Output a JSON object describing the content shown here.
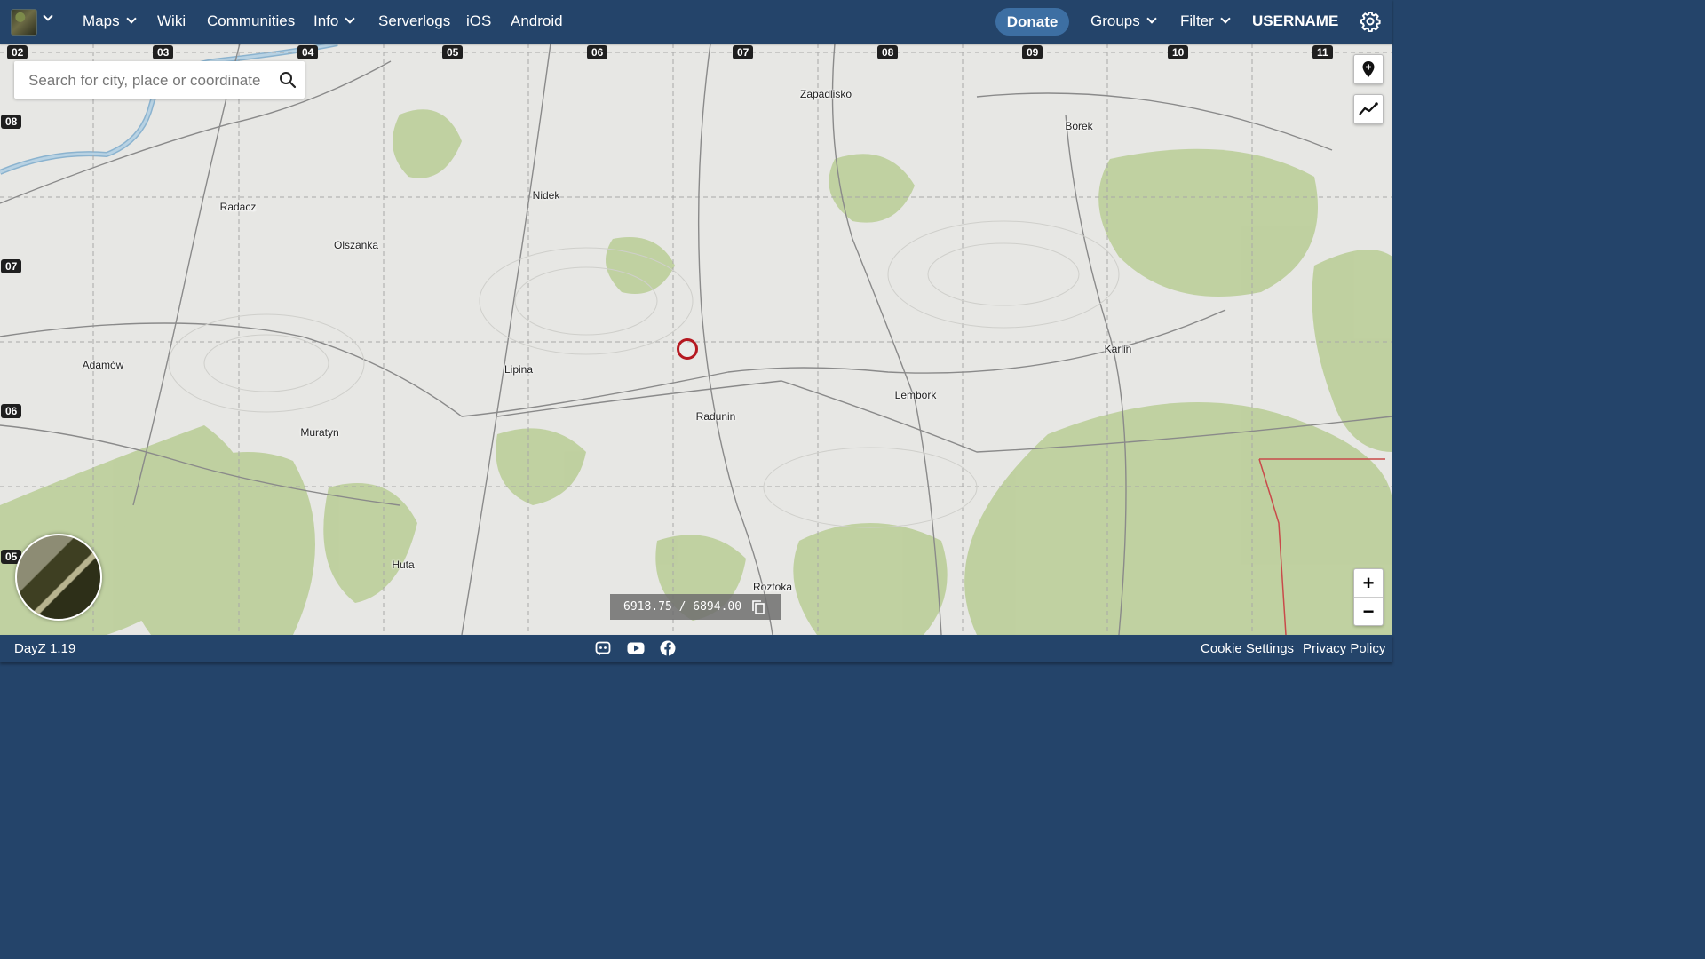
{
  "nav": {
    "items": [
      "Maps",
      "Wiki",
      "Communities",
      "Info",
      "Serverlogs",
      "iOS",
      "Android"
    ],
    "donate": "Donate",
    "groups": "Groups",
    "filter": "Filter",
    "username": "USERNAME"
  },
  "map": {
    "search_placeholder": "Search for city, place or coordinate",
    "coordinates": "6918.75 / 6894.00",
    "grid_top": [
      "02",
      "03",
      "04",
      "05",
      "06",
      "07",
      "08",
      "09",
      "10",
      "11"
    ],
    "grid_left": [
      "08",
      "07",
      "06",
      "05"
    ],
    "places": [
      "Zapadlisko",
      "Borek",
      "Nidek",
      "Radacz",
      "Olszanka",
      "Adamów",
      "Lipina",
      "Karlin",
      "Lembork",
      "Radunin",
      "Muratyn",
      "Huta",
      "Roztoka"
    ],
    "zoom_in": "+",
    "zoom_out": "−"
  },
  "footer": {
    "version": "DayZ 1.19",
    "cookie": "Cookie Settings",
    "privacy": "Privacy Policy"
  },
  "colors": {
    "nav_bg": "#24446a",
    "donate_bg": "#3d6fa3",
    "marker": "#b51820"
  }
}
